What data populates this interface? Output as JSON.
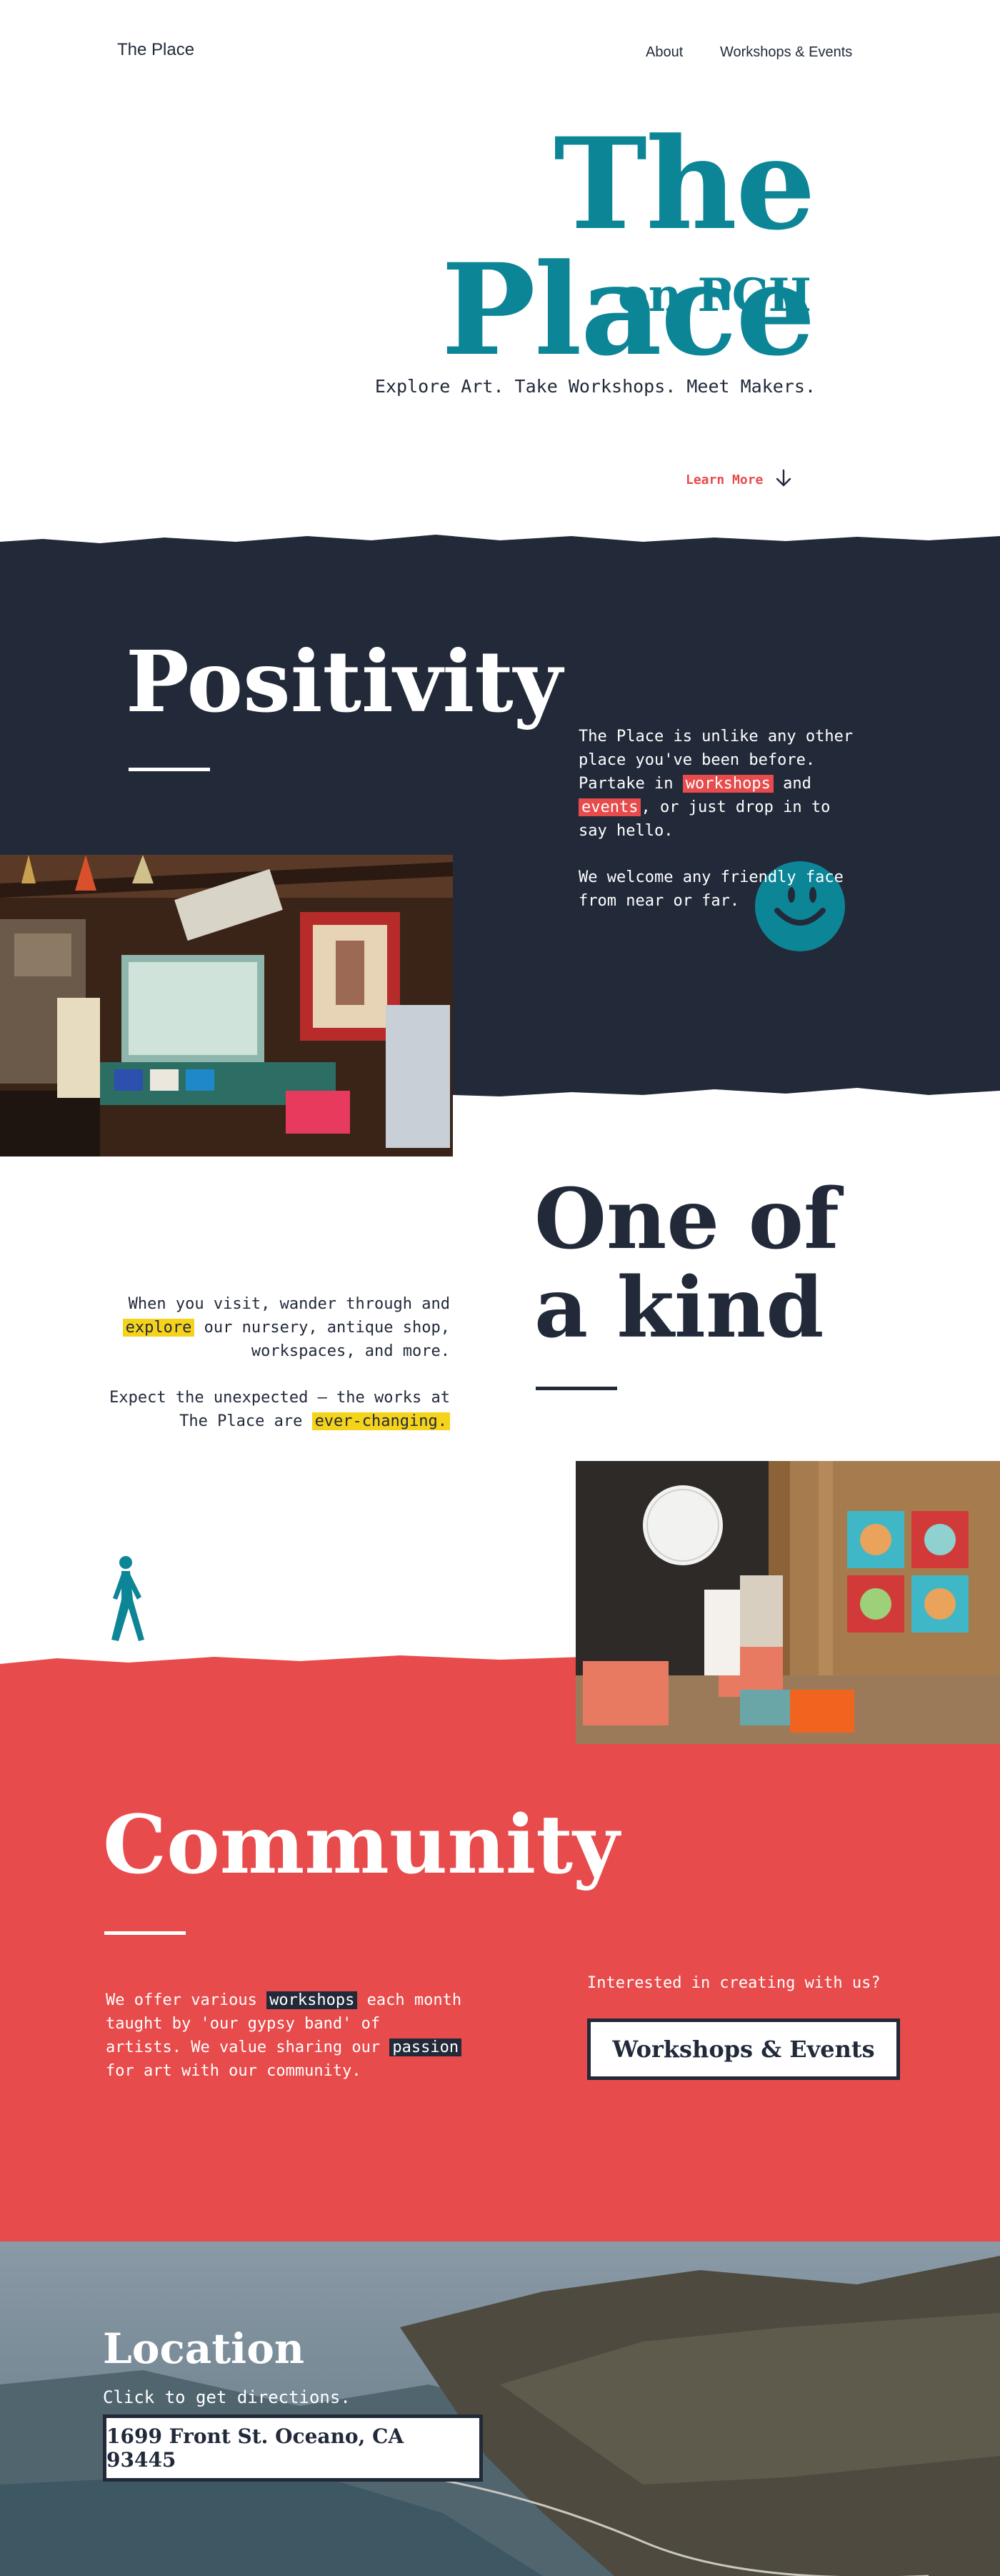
{
  "colors": {
    "teal": "#0c8597",
    "navy": "#222a3a",
    "coral": "#e84b4b",
    "yellow": "#f6d31b",
    "white": "#ffffff"
  },
  "nav": {
    "brand": "The Place",
    "links": [
      "About",
      "Workshops & Events"
    ]
  },
  "hero": {
    "title": "The Place",
    "subtitle": "on PCH",
    "tagline": "Explore Art. Take Workshops. Meet Makers.",
    "learn_more": "Learn More",
    "learn_more_icon": "arrow-down-icon"
  },
  "positivity": {
    "title": "Positivity",
    "p1_before": "The Place is unlike any other place you've been before. Partake in ",
    "p1_hl1": "workshops",
    "p1_mid": " and ",
    "p1_hl2": "events",
    "p1_after": ", or just drop in to say hello.",
    "p2": "We welcome any friendly face from near or far.",
    "icon": "smiley-face-icon"
  },
  "one_of_a_kind": {
    "title": "One of a kind",
    "p1_before": "When you visit, wander through and ",
    "p1_hl": "explore",
    "p1_after": " our nursery, antique shop, workspaces, and more.",
    "p2_before": "Expect the unexpected – the works at The Place are ",
    "p2_hl": "ever-changing.",
    "icon": "walking-person-icon"
  },
  "community": {
    "title": "Community",
    "p_before": "We offer various ",
    "p_hl1": "workshops",
    "p_mid": " each month taught by 'our gypsy band' of artists. We value sharing our ",
    "p_hl2": "passion",
    "p_after": " for art with our community.",
    "cta_label": "Interested in creating with us?",
    "cta_button": "Workshops & Events"
  },
  "location": {
    "title": "Location",
    "subtitle": "Click to get directions.",
    "address": "1699 Front St. Oceano, CA 93445"
  }
}
